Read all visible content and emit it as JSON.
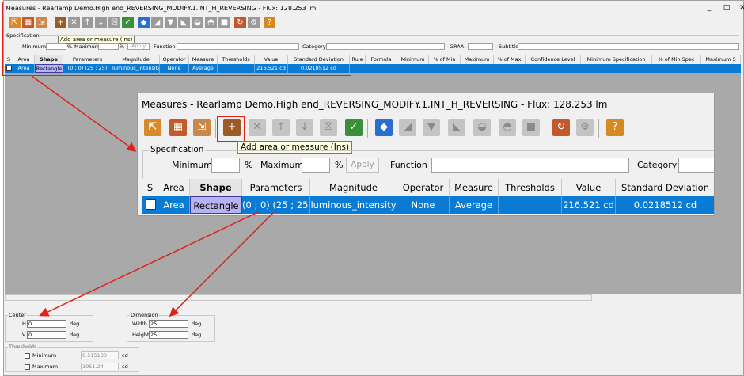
{
  "window": {
    "title": "Measures - Rearlamp Demo.High end_REVERSING_MODIFY.1.INT_H_REVERSING - Flux: 128.253 lm"
  },
  "window_controls": {
    "minimize": "_",
    "restore": "□",
    "close": "✕"
  },
  "toolbar": {
    "tooltip": "Add area or measure (Ins)",
    "icons": [
      "import-icon",
      "grid-icon",
      "export-icon",
      "add-area-icon",
      "delete-area-icon",
      "move-up-icon",
      "move-down-icon",
      "clear-icon",
      "validate-icon",
      "colormap-icon",
      "chart-icon",
      "shape1-icon",
      "shape2-icon",
      "shape3-icon",
      "shape4-icon",
      "square-icon",
      "refresh-icon",
      "settings-icon",
      "help-icon"
    ]
  },
  "specification": {
    "legend": "Specification",
    "minimum_label": "Minimum",
    "minimum_value": "",
    "minimum_unit": "%",
    "maximum_label": "Maximum",
    "maximum_value": "",
    "maximum_unit": "%",
    "apply_label": "Apply",
    "function_label": "Function",
    "function_value": "",
    "category_label": "Category",
    "category_value": "",
    "graa_label": "GRAA",
    "graa_value": "",
    "subtitle_label": "Subtitle",
    "subtitle_value": ""
  },
  "grid": {
    "columns": [
      "S",
      "Area",
      "Shape",
      "Parameters",
      "Magnitude",
      "Operator",
      "Measure",
      "Thresholds",
      "Value",
      "Standard Deviation",
      "Rule",
      "Formula",
      "Minimum",
      "% of Min",
      "Maximum",
      "% of Max",
      "Confidence Level",
      "Minimum Specification",
      "% of Min Spec",
      "Maximum S"
    ],
    "row": {
      "area": "Area",
      "shape": "Rectangle",
      "parameters": "(0 ; 0) (25 ; 25)",
      "magnitude": "luminous_intensity",
      "operator": "None",
      "measure": "Average",
      "thresholds": "",
      "value": "216.521 cd",
      "std_dev": "0.0218512 cd"
    }
  },
  "center": {
    "legend": "Center",
    "h_label": "H",
    "h_value": "0",
    "v_label": "V",
    "v_value": "0",
    "unit": "deg"
  },
  "dimension": {
    "legend": "Dimension",
    "width_label": "Width",
    "width_value": "25",
    "height_label": "Height",
    "height_value": "25",
    "unit": "deg"
  },
  "thresholds": {
    "legend": "Thresholds",
    "minimum_label": "Minimum",
    "minimum_value": "0.515133",
    "maximum_label": "Maximum",
    "maximum_value": "1951.24",
    "unit": "cd"
  },
  "colors": {
    "selection": "#0a7bd4",
    "shape_highlight": "#b7b2f0",
    "annotation_red": "#e0201a",
    "tooltip_bg": "#ffffe1"
  }
}
